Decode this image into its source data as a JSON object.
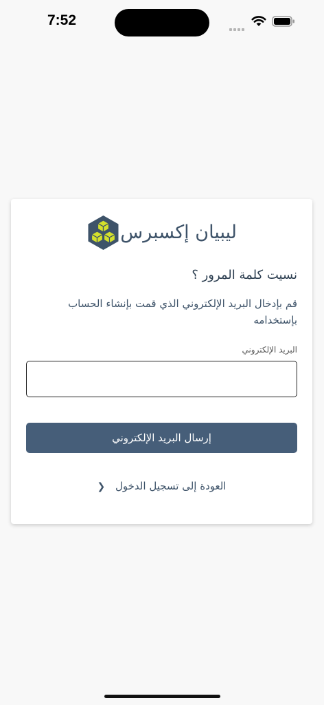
{
  "status_bar": {
    "time": "7:52"
  },
  "brand": {
    "name": "ليبيان إكسبرس",
    "logo_icon": "yellow-cubes-hexagon-logo"
  },
  "form": {
    "title": "نسيت كلمة المرور ؟",
    "description": "قم بإدخال البريد الإلكتروني الذي قمت بإنشاء الحساب بإستخدامه",
    "email_label": "البريد الإلكتروني",
    "email_value": "",
    "submit_label": "إرسال البريد الإلكتروني",
    "back_link": "العودة إلى تسجيل الدخول",
    "back_icon": "chevron-left-icon"
  },
  "colors": {
    "primary": "#465e79",
    "text": "#3e5369",
    "logo_bg": "#3e5369",
    "logo_accent": "#d4e02b",
    "background": "#f8f8f8"
  }
}
